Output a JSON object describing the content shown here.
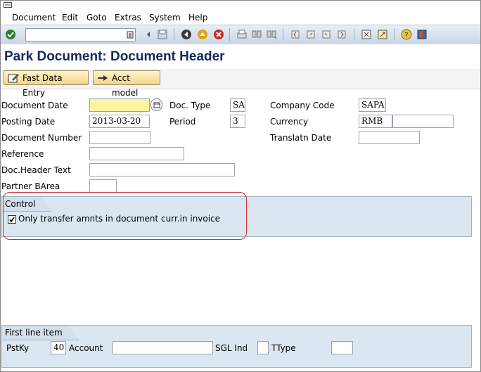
{
  "menu": {
    "items": [
      "Document",
      "Edit",
      "Goto",
      "Extras",
      "System",
      "Help"
    ]
  },
  "toolbar": {
    "command_value": "",
    "icons": [
      "enter-icon",
      "back-icon",
      "exit-icon",
      "cancel-icon",
      "print-icon",
      "find-icon",
      "find-next-icon",
      "first-page-icon",
      "previous-page-icon",
      "next-page-icon",
      "last-page-icon",
      "create-session-icon",
      "shortcut-icon",
      "help-icon",
      "customize-layout-icon"
    ]
  },
  "title": "Park Document: Document Header",
  "app_toolbar": {
    "fast_data_entry": "Fast Data Entry",
    "acct_model": "Acct model"
  },
  "form": {
    "document_date": {
      "label": "Document Date",
      "value": ""
    },
    "doc_type": {
      "label": "Doc. Type",
      "value": "SA"
    },
    "company_code": {
      "label": "Company Code",
      "value": "SAPA"
    },
    "posting_date": {
      "label": "Posting Date",
      "value": "2013-03-20"
    },
    "period": {
      "label": "Period",
      "value": "3"
    },
    "currency": {
      "label": "Currency",
      "value": "RMB",
      "rate": ""
    },
    "document_number": {
      "label": "Document Number",
      "value": ""
    },
    "translatn_date": {
      "label": "Translatn Date",
      "value": ""
    },
    "reference": {
      "label": "Reference",
      "value": ""
    },
    "doc_header_text": {
      "label": "Doc.Header Text",
      "value": ""
    },
    "partner_barea": {
      "label": "Partner BArea",
      "value": ""
    }
  },
  "control": {
    "title": "Control",
    "checkbox_label": "Only transfer amnts in document curr.in invoice",
    "checked": true
  },
  "first_line_item": {
    "title": "First line item",
    "pstky": {
      "label": "PstKy",
      "value": "40"
    },
    "account": {
      "label": "Account",
      "value": ""
    },
    "sgl_ind": {
      "label": "SGL Ind",
      "value": ""
    },
    "ttype": {
      "label": "TType",
      "value": ""
    }
  },
  "colors": {
    "title": "#14285a",
    "required_field": "#fff4a3",
    "group_background": "#dbe6f0",
    "highlight": "#d03030"
  }
}
